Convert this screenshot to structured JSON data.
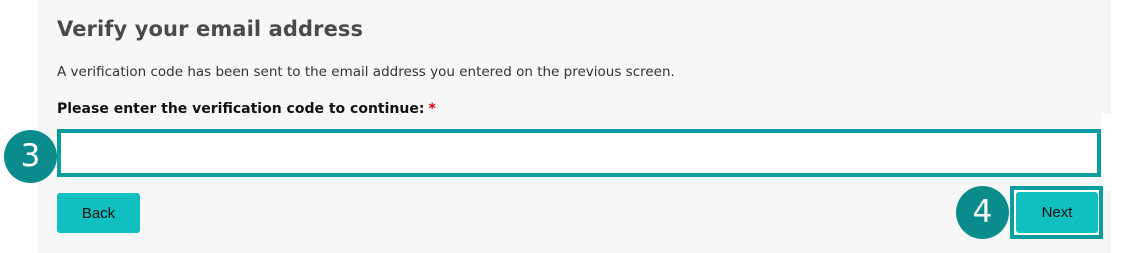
{
  "form": {
    "title": "Verify your email address",
    "subtitle": "A verification code has been sent to the email address you entered on the previous screen.",
    "field_label": "Please enter the verification code to continue:",
    "required_marker": "*",
    "code_value": "",
    "code_placeholder": ""
  },
  "actions": {
    "back_label": "Back",
    "next_label": "Next"
  },
  "annotations": {
    "step_3": "3",
    "step_4": "4"
  },
  "colors": {
    "accent": "#10bfbf",
    "highlight": "#0a9e9e",
    "badge": "#0a8c8c",
    "required": "#d0021b",
    "panel": "#f7f7f7"
  }
}
